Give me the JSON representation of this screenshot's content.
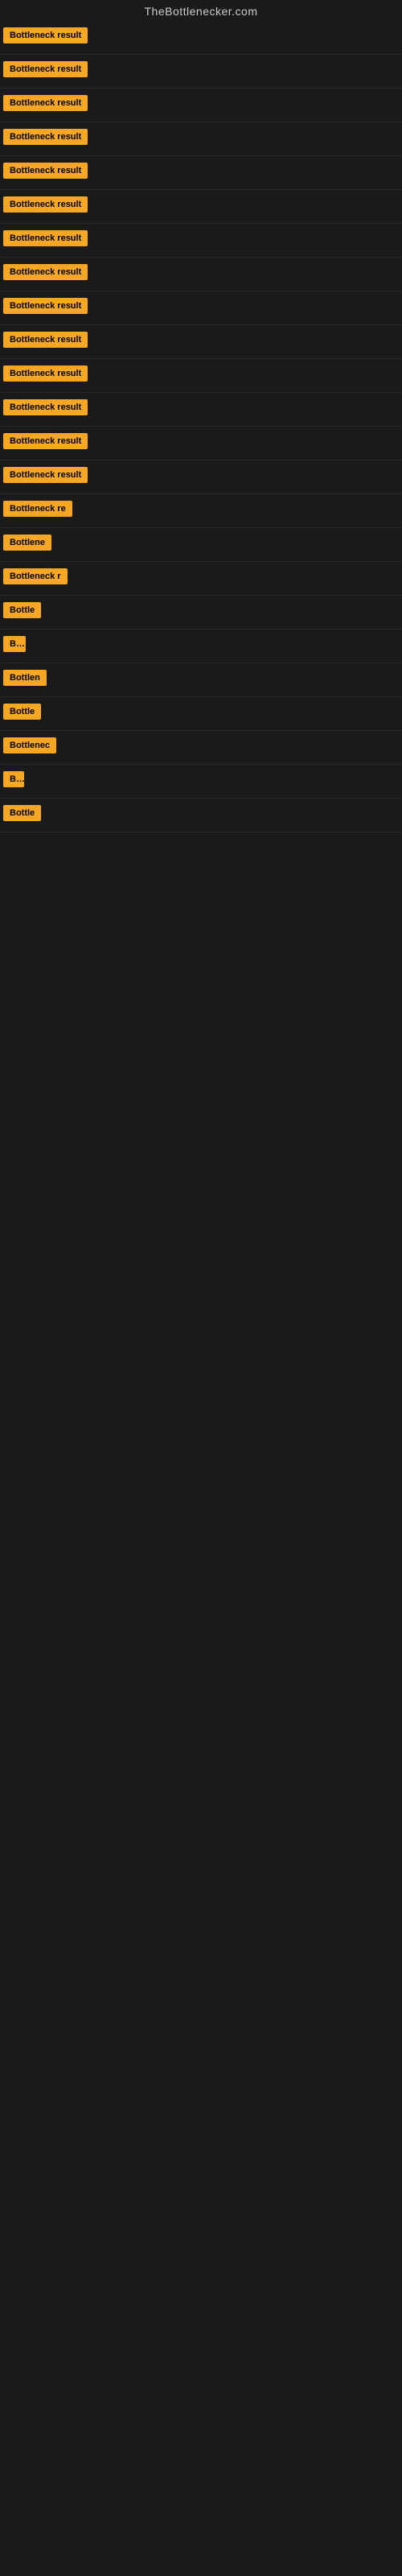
{
  "site": {
    "title": "TheBottlenecker.com"
  },
  "badges": [
    {
      "label": "Bottleneck result",
      "width": 120
    },
    {
      "label": "Bottleneck result",
      "width": 120
    },
    {
      "label": "Bottleneck result",
      "width": 120
    },
    {
      "label": "Bottleneck result",
      "width": 120
    },
    {
      "label": "Bottleneck result",
      "width": 120
    },
    {
      "label": "Bottleneck result",
      "width": 120
    },
    {
      "label": "Bottleneck result",
      "width": 120
    },
    {
      "label": "Bottleneck result",
      "width": 120
    },
    {
      "label": "Bottleneck result",
      "width": 120
    },
    {
      "label": "Bottleneck result",
      "width": 120
    },
    {
      "label": "Bottleneck result",
      "width": 120
    },
    {
      "label": "Bottleneck result",
      "width": 120
    },
    {
      "label": "Bottleneck result",
      "width": 120
    },
    {
      "label": "Bottleneck result",
      "width": 120
    },
    {
      "label": "Bottleneck re",
      "width": 100
    },
    {
      "label": "Bottlene",
      "width": 80
    },
    {
      "label": "Bottleneck r",
      "width": 90
    },
    {
      "label": "Bottle",
      "width": 60
    },
    {
      "label": "Bo",
      "width": 28
    },
    {
      "label": "Bottlen",
      "width": 70
    },
    {
      "label": "Bottle",
      "width": 55
    },
    {
      "label": "Bottlenec",
      "width": 85
    },
    {
      "label": "Bo",
      "width": 26
    },
    {
      "label": "Bottle",
      "width": 58
    }
  ]
}
